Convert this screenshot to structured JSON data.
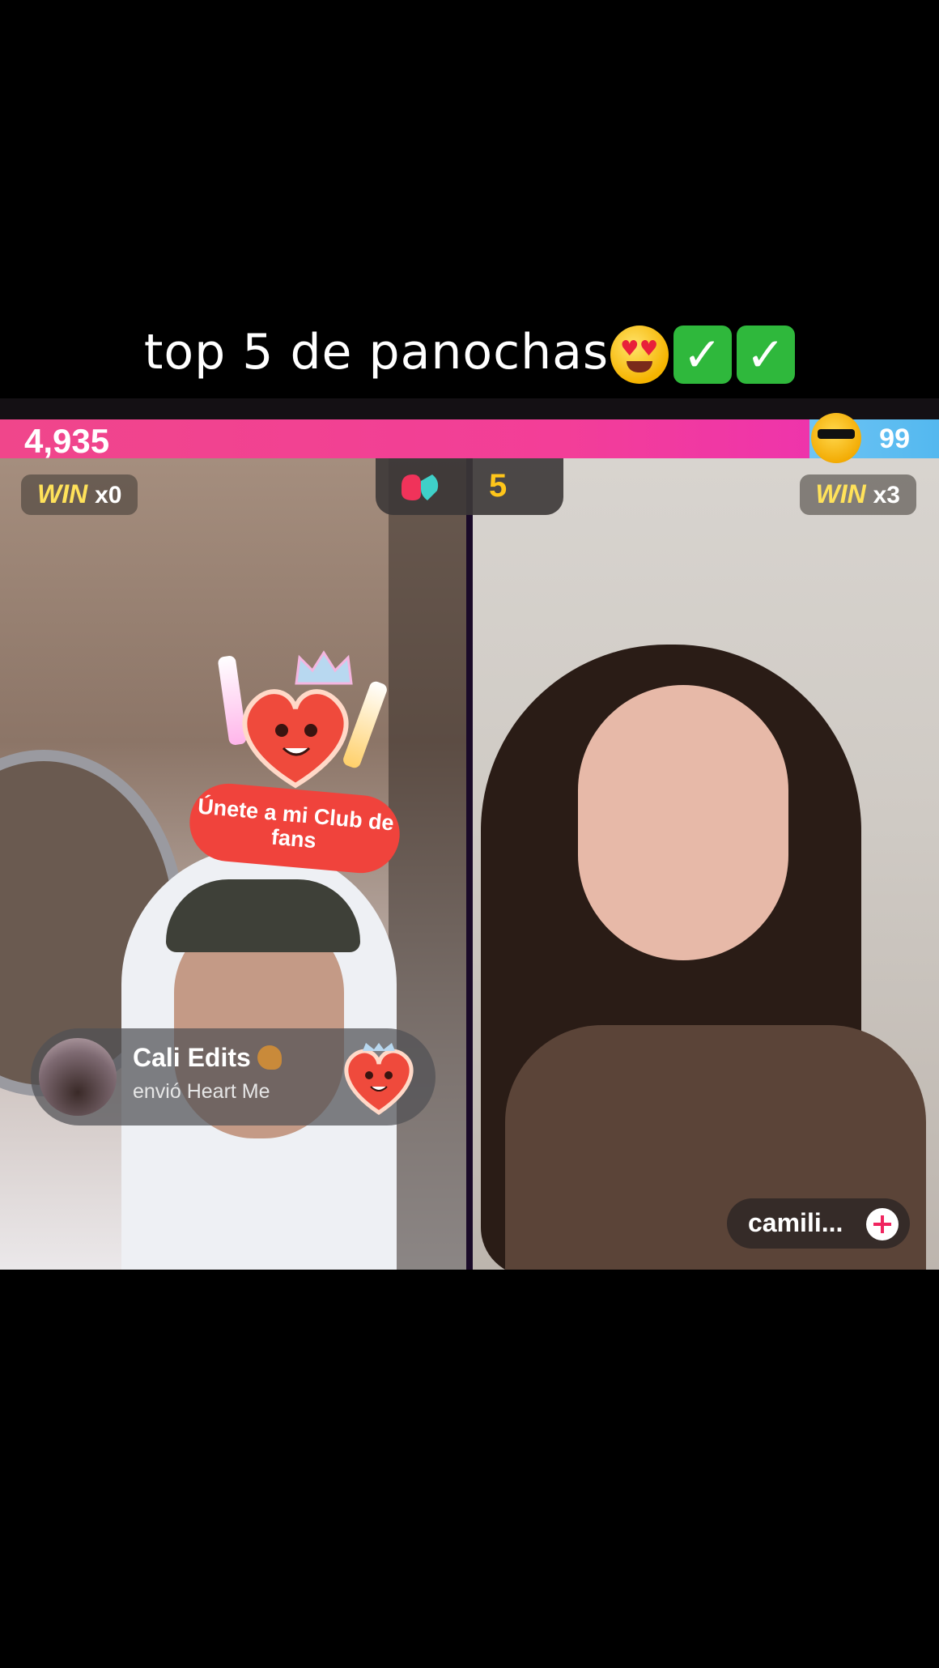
{
  "caption": {
    "text": "top 5 de panochas"
  },
  "caption_emojis": [
    "smiling-face-with-heart-eyes",
    "check-mark-button",
    "check-mark-button"
  ],
  "battle": {
    "left_score": "4,935",
    "right_score": "99",
    "timer": "5",
    "left_win": {
      "word": "WIN",
      "count": "x0"
    },
    "right_win": {
      "word": "WIN",
      "count": "x3"
    }
  },
  "sticker": {
    "text": "Únete a mi Club de fans"
  },
  "gift": {
    "sender": "Cali Edits",
    "message": "envió Heart Me"
  },
  "host_right": {
    "username": "camili..."
  },
  "colors": {
    "score_left": "#f0468b",
    "score_right": "#53b8ef",
    "win_accent": "#ffe25a",
    "timer_accent": "#ffc61a"
  }
}
